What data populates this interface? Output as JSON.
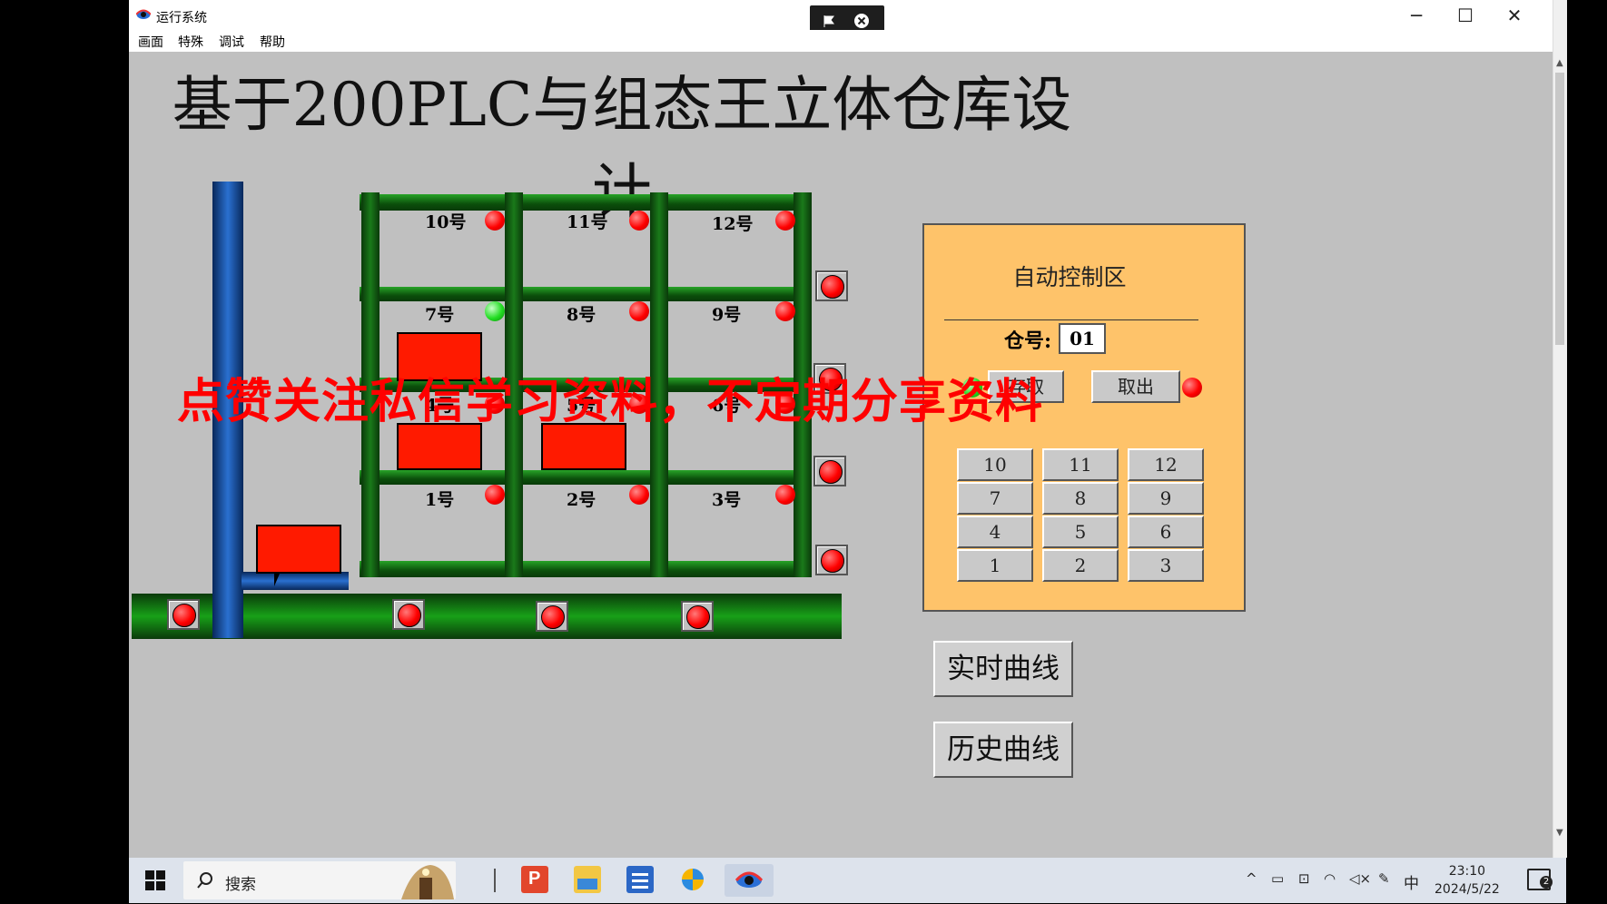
{
  "window": {
    "title": "运行系统",
    "menu": [
      "画面",
      "特殊",
      "调试",
      "帮助"
    ],
    "controls": {
      "minimize": "─",
      "maximize": "☐",
      "close": "✕"
    }
  },
  "main": {
    "title": "基于200PLC与组态王立体仓库设计",
    "slots": {
      "s10": "10号",
      "s11": "11号",
      "s12": "12号",
      "s7": "7号",
      "s8": "8号",
      "s9": "9号",
      "s4": "4号",
      "s5": "5号",
      "s6": "6号",
      "s1": "1号",
      "s2": "2号",
      "s3": "3号"
    },
    "watermark": "点赞关注私信学习资料，不定期分享资料"
  },
  "control_panel": {
    "title": "自动控制区",
    "cang_label": "仓号:",
    "cang_value": "01",
    "store_label": "存取",
    "fetch_label": "取出",
    "numbers": [
      "10",
      "11",
      "12",
      "7",
      "8",
      "9",
      "4",
      "5",
      "6",
      "1",
      "2",
      "3"
    ]
  },
  "buttons": {
    "realtime": "实时曲线",
    "history": "历史曲线"
  },
  "taskbar": {
    "search_placeholder": "搜索",
    "ime": "中",
    "time": "23:10",
    "date": "2024/5/22",
    "notifications": "2"
  }
}
